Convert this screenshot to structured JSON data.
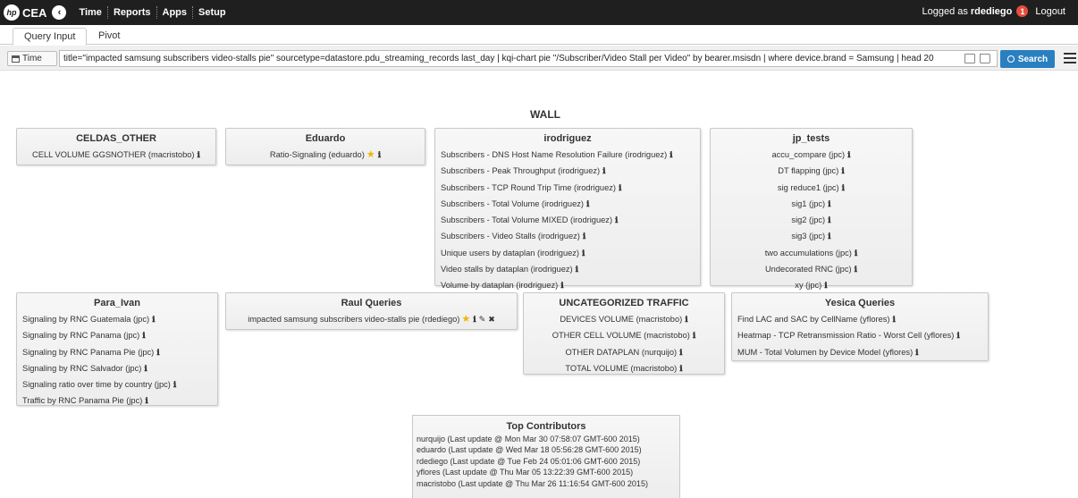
{
  "app": {
    "logo": "hp",
    "brand": "CEA"
  },
  "menu": {
    "time": "Time",
    "reports": "Reports",
    "apps": "Apps",
    "setup": "Setup"
  },
  "user": {
    "prefix": "Logged as",
    "name": "rdediego",
    "notifications": "1",
    "logout": "Logout"
  },
  "tabs": [
    {
      "label": "Query Input",
      "active": true
    },
    {
      "label": "Pivot",
      "active": false
    }
  ],
  "query": {
    "time_label": "Time",
    "value": "title=\"impacted samsung subscribers video-stalls pie\" sourcetype=datastore.pdu_streaming_records last_day | kqi-chart pie \"/Subscriber/Video Stall per Video\" by bearer.msisdn | where device.brand = Samsung | head 20",
    "search_label": "Search"
  },
  "wall": {
    "title": "WALL",
    "panels": [
      {
        "title": "CELDAS_OTHER",
        "items": [
          "CELL VOLUME GGSNOTHER (macristobo)"
        ]
      },
      {
        "title": "Eduardo",
        "items": [
          "Ratio-Signaling (eduardo)"
        ]
      },
      {
        "title": "irodriguez",
        "items": [
          "Subscribers - DNS Host Name Resolution Failure (irodriguez)",
          "Subscribers - Peak Throughput (irodriguez)",
          "Subscribers - TCP Round Trip Time (irodriguez)",
          "Subscribers - Total Volume (irodriguez)",
          "Subscribers - Total Volume MIXED (irodriguez)",
          "Subscribers - Video Stalls (irodriguez)",
          "Unique users by dataplan (irodriguez)",
          "Video stalls by dataplan (irodriguez)",
          "Volume by dataplan (irodriguez)"
        ]
      },
      {
        "title": "jp_tests",
        "items": [
          "accu_compare (jpc)",
          "DT flapping (jpc)",
          "sig reduce1 (jpc)",
          "sig1 (jpc)",
          "sig2 (jpc)",
          "sig3 (jpc)",
          "two accumulations (jpc)",
          "Undecorated RNC (jpc)",
          "xy (jpc)"
        ]
      },
      {
        "title": "Para_Ivan",
        "items": [
          "Signaling by RNC Guatemala (jpc)",
          "Signaling by RNC Panama (jpc)",
          "Signaling by RNC Panama Pie (jpc)",
          "Signaling by RNC Salvador (jpc)",
          "Signaling ratio over time by country (jpc)",
          "Traffic by RNC Panama Pie (jpc)"
        ]
      },
      {
        "title": "Raul Queries",
        "items": [
          "impacted samsung subscribers video-stalls pie (rdediego)"
        ]
      },
      {
        "title": "UNCATEGORIZED TRAFFIC",
        "items": [
          "DEVICES VOLUME (macristobo)",
          "OTHER CELL VOLUME (macristobo)",
          "OTHER DATAPLAN (nurquijo)",
          "TOTAL VOLUME (macristobo)"
        ]
      },
      {
        "title": "Yesica Queries",
        "items": [
          "Find LAC and SAC by CellName (yflores)",
          "Heatmap - TCP Retransmission Ratio - Worst Cell (yflores)",
          "MUM - Total Volumen by Device Model (yflores)"
        ]
      }
    ]
  },
  "contributors": {
    "title": "Top Contributors",
    "items": [
      "nurquijo (Last update @ Mon Mar 30 07:58:07 GMT-600 2015)",
      "eduardo (Last update @ Wed Mar 18 05:56:28 GMT-600 2015)",
      "rdediego (Last update @ Tue Feb 24 05:01:06 GMT-600 2015)",
      "yflores (Last update @ Thu Mar 05 13:22:39 GMT-600 2015)",
      "macristobo (Last update @ Thu Mar 26 11:16:54 GMT-600 2015)"
    ]
  },
  "glyphs": {
    "info": "ℹ",
    "star": "★",
    "edit": "✎",
    "delete": "✖"
  },
  "colors": {
    "topbar": "#1f1f1f",
    "search_button": "#2a7fc1",
    "badge": "#e74c3c",
    "star": "#f0b400"
  }
}
